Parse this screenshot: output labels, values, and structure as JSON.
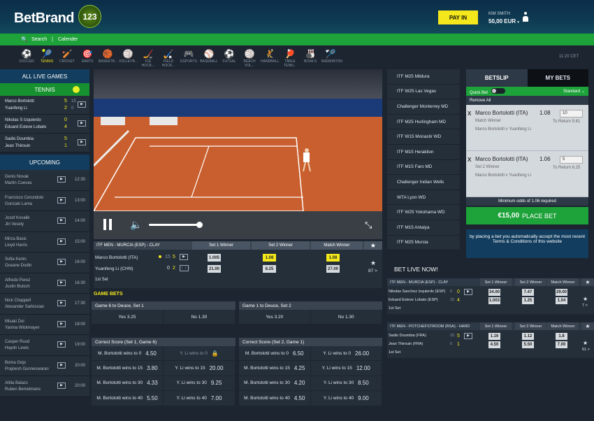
{
  "brand": {
    "name": "BetBrand",
    "badge": "123"
  },
  "account": {
    "pay_in": "PAY IN",
    "user": "KIM SMITH",
    "balance": "50,00 EUR"
  },
  "subnav": {
    "search": "Search",
    "sep": "|",
    "calendar": "Calender"
  },
  "sports": [
    {
      "label": "SOCCER",
      "icon": "⚽"
    },
    {
      "label": "TENNIS",
      "icon": "🎾"
    },
    {
      "label": "CRICKET",
      "icon": "🏏"
    },
    {
      "label": "DARTS",
      "icon": "🎯"
    },
    {
      "label": "BASKETB...",
      "icon": "🏀"
    },
    {
      "label": "VOLLEYB...",
      "icon": "🏐"
    },
    {
      "label": "ICE HOCK...",
      "icon": "🏒"
    },
    {
      "label": "FIELD HOCK...",
      "icon": "🏑"
    },
    {
      "label": "ESPORTS",
      "icon": "🎮"
    },
    {
      "label": "BASEBALL",
      "icon": "⚾"
    },
    {
      "label": "FUTSAL",
      "icon": "⚽"
    },
    {
      "label": "BEACH VOL...",
      "icon": "🏐"
    },
    {
      "label": "HANDBALL",
      "icon": "🤾"
    },
    {
      "label": "TABLE TENN...",
      "icon": "🏓"
    },
    {
      "label": "BOWLS",
      "icon": "🎳"
    },
    {
      "label": "BADMINTON",
      "icon": "🏸"
    }
  ],
  "clock": "11:20 CET",
  "left": {
    "all_live": "ALL LIVE GAMES",
    "tennis": "TENNIS",
    "upcoming": "UPCOMING",
    "live_matches": [
      {
        "p1": "Marco Bortolotti",
        "p2": "Yuanfeng Li",
        "s1": "5",
        "g1": "15",
        "s2": "2",
        "g2": "0"
      },
      {
        "p1": "Nikolas S Izquierdo",
        "p2": "Eduard Esteve Lobato",
        "s1": "0",
        "g1": "",
        "s2": "4",
        "g2": ""
      },
      {
        "p1": "Sadio Doumbia",
        "p2": "Jean Thirouin",
        "s1": "5",
        "g1": "",
        "s2": "1",
        "g2": ""
      }
    ],
    "upcoming_matches": [
      {
        "p1": "Denis Novak",
        "p2": "Martin Cuevas",
        "time": "12:30"
      },
      {
        "p1": "Francisco Cerundolo",
        "p2": "Gonzalo Lama",
        "time": "13:00"
      },
      {
        "p1": "Jozef Kovalik",
        "p2": "Jiri Vesely",
        "time": "14:00"
      },
      {
        "p1": "Mirza Basic",
        "p2": "Lloyd Harris",
        "time": "15:00"
      },
      {
        "p1": "Sofia Kenin",
        "p2": "Oceane Dodin",
        "time": "16:00"
      },
      {
        "p1": "Alfredo Perez",
        "p2": "Justin Butsch",
        "time": "16:30"
      },
      {
        "p1": "Nick Chappell",
        "p2": "Alexander Sarkissian",
        "time": "17:30"
      },
      {
        "p1": "Misaki Doi",
        "p2": "Yanina Wickmayer",
        "time": "18:00"
      },
      {
        "p1": "Casper Ruud",
        "p2": "Haydn Lewis",
        "time": "19:00"
      },
      {
        "p1": "Boma Gojo",
        "p2": "Prajnesh Gunneswaran",
        "time": "20:00"
      },
      {
        "p1": "Attila Balazs",
        "p2": "Ruben Bemelmans",
        "time": "20:00"
      }
    ],
    "tv": "▶"
  },
  "tournaments": [
    "ITF M25 Mildura",
    "ITF W25 Las Vegas",
    "Challenger Monterrey MD",
    "ITF M25 Hurlingham MD",
    "ITF W15 Monastir WD",
    "ITF M15 Heraklion",
    "ITF M15 Faro MD",
    "Challenger Indian Wells",
    "WTA Lyon WD",
    "ITF W25 Yokohama WD",
    "ITF M15 Antalya",
    "ITF M25 Murcia"
  ],
  "betslip": {
    "tab_slip": "BETSLIP",
    "tab_mybets": "MY BETS",
    "quick_bet": "Quick Bet",
    "standard": "Standard",
    "remove_all": "Remove All",
    "selections": [
      {
        "name": "Marco Bortolotti (ITA)",
        "odds": "1.08",
        "market": "Match Winner",
        "event": "Marco Bortolotti v Yuanfeng Li",
        "stake": "10",
        "return": "To Return 9.61"
      },
      {
        "name": "Marco Bortolotti (ITA)",
        "odds": "1.06",
        "market": "Set 2 Winner",
        "event": "Marco Bortolotti v Yuanfeng Li",
        "stake": "5",
        "return": "To Return 6.25"
      }
    ],
    "min_odds": "Minimum odds of 1.06 required",
    "amount": "€15,00",
    "place": "PLACE BET",
    "note": "by placing a bet you automatically accept the most recent Terms & Conditions of this website"
  },
  "main_market": {
    "event": "ITF MEN - MURCIA (ESP) - CLAY",
    "cols": [
      "Set 1 Winner",
      "Set 2 Winner",
      "Match Winner"
    ],
    "p1": "Marco Bortolotti (ITA)",
    "p1_g": "15",
    "p1_s": "5",
    "p2": "Yuanfeng Li (CHN)",
    "p2_s": "0",
    "p2_g": "2",
    "odds1": [
      "1.005",
      "1.08",
      "1.08"
    ],
    "odds2": [
      "21.00",
      "8.25",
      "27.00"
    ],
    "set": "1st Set",
    "more": "87 >"
  },
  "game_bets": {
    "title": "GAME BETS",
    "g1": {
      "title": "Game 6 to Deuce, Set 1",
      "yes": "Yes 3.25",
      "no": "No 1.30"
    },
    "g2": {
      "title": "Game 1 to Deuce, Set 2",
      "yes": "Yes 3.20",
      "no": "No 1.30"
    },
    "cs1": {
      "title": "Correct Score (Set 1, Game 6)",
      "rows": [
        [
          "M. Bortolotti wins to 0",
          "4.50",
          "Y. Li wins to 0",
          "🔒"
        ],
        [
          "M. Bortolotti wins to 15",
          "3.80",
          "Y. Li wins to 15",
          "20.00"
        ],
        [
          "M. Bortolotti wins to 30",
          "4.33",
          "Y. Li wins to 30",
          "9.25"
        ],
        [
          "M. Bortolotti wins to 40",
          "5.50",
          "Y. Li wins to 40",
          "7.00"
        ]
      ]
    },
    "cs2": {
      "title": "Correct Score (Set 2, Game 1)",
      "rows": [
        [
          "M. Bortolotti wins to 0",
          "6.50",
          "Y. Li wins to 0",
          "26.00"
        ],
        [
          "M. Bortolotti wins to 15",
          "4.25",
          "Y. Li wins to 15",
          "12.00"
        ],
        [
          "M. Bortolotti wins to 30",
          "4.20",
          "Y. Li wins to 30",
          "8.50"
        ],
        [
          "M. Bortolotti wins to 40",
          "4.50",
          "Y. Li wins to 40",
          "9.00"
        ]
      ]
    }
  },
  "bet_live": {
    "title": "BET LIVE NOW!",
    "cols": [
      "Set 1 Winner",
      "Set 2 Winner",
      "Match Winner"
    ],
    "e1": {
      "event": "ITF MEN - MURCIA (ESP) - CLAY",
      "p1": "Nikolas Sanchez Izquierdo (ESP)",
      "p1_s": "0",
      "p1_g": "0",
      "p2": "Eduard Esteve Lobato (ESP)",
      "p2_g": "15",
      "p2_s": "4",
      "o1": [
        "34.00",
        "7.47",
        "29.00"
      ],
      "o2": [
        "1.003",
        "1.25",
        "1.04"
      ],
      "set": "1st Set",
      "more": "7 >"
    },
    "e2": {
      "event": "ITF MEN - POTCHEFSTROOM (RSA) - HARD",
      "p1": "Sadio Doumbia (FRA)",
      "p1_g": "15",
      "p1_s": "5",
      "p2": "Jean Thirouin (FRA)",
      "p2_g": "0",
      "p2_s": "1",
      "o1": [
        "1.16",
        "1.12",
        "1.8"
      ],
      "o2": [
        "4.50",
        "5.50",
        "7.00"
      ],
      "set": "1st Set",
      "more": "61 >"
    }
  }
}
